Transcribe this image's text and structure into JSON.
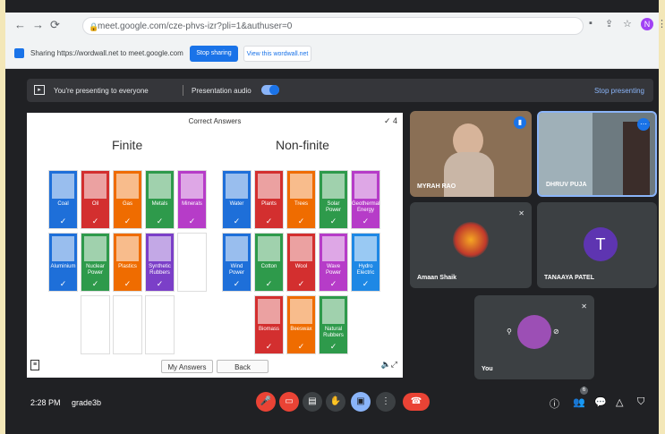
{
  "browser": {
    "url": "meet.google.com/cze-phvs-izr?pli=1&authuser=0",
    "profile_initial": "N"
  },
  "sharing": {
    "text": "Sharing https://wordwall.net to meet.google.com",
    "stop_label": "Stop sharing",
    "view_label": "View this wordwall.net"
  },
  "present_bar": {
    "presenting_text": "You're presenting to everyone",
    "audio_label": "Presentation audio",
    "stop_label": "Stop presenting"
  },
  "activity": {
    "title": "Correct Answers",
    "score": "4",
    "finite_heading": "Finite",
    "nonfinite_heading": "Non-finite",
    "finite": [
      {
        "label": "Coal",
        "color": "#1e6fd9"
      },
      {
        "label": "Oil",
        "color": "#d32f2f"
      },
      {
        "label": "Gas",
        "color": "#ef6c00"
      },
      {
        "label": "Metals",
        "color": "#2e9a4b"
      },
      {
        "label": "Minerals",
        "color": "#b63cc8"
      },
      {
        "label": "Aluminium",
        "color": "#1e6fd9"
      },
      {
        "label": "Nuclear Power",
        "color": "#2e9a4b"
      },
      {
        "label": "Plastics",
        "color": "#ef6c00"
      },
      {
        "label": "Synthetic Rubbers",
        "color": "#7b3fc8"
      }
    ],
    "nonfinite": [
      {
        "label": "Water",
        "color": "#1e6fd9"
      },
      {
        "label": "Plants",
        "color": "#d32f2f"
      },
      {
        "label": "Trees",
        "color": "#ef6c00"
      },
      {
        "label": "Solar Power",
        "color": "#2e9a4b"
      },
      {
        "label": "Geothermal Energy",
        "color": "#b63cc8"
      },
      {
        "label": "Wind Power",
        "color": "#1e6fd9"
      },
      {
        "label": "Cotton",
        "color": "#2e9a4b"
      },
      {
        "label": "Wool",
        "color": "#d32f2f"
      },
      {
        "label": "Wave Power",
        "color": "#b63cc8"
      },
      {
        "label": "Hydro Electric",
        "color": "#1e88e5"
      },
      {
        "label": "Biomass",
        "color": "#d32f2f"
      },
      {
        "label": "Beeswax",
        "color": "#ef6c00"
      },
      {
        "label": "Natural Rubbers",
        "color": "#2e9a4b"
      }
    ],
    "my_answers_label": "My Answers",
    "back_label": "Back"
  },
  "participants": {
    "p1": "MYRAH RAO",
    "p2": "DHRUV PUJA",
    "p3": "Amaan Shaik",
    "p4": "TANAAYA PATEL",
    "p4_initial": "T",
    "self": "You"
  },
  "controls": {
    "time": "2:28 PM",
    "meeting": "grade3b",
    "people_count": "6"
  }
}
